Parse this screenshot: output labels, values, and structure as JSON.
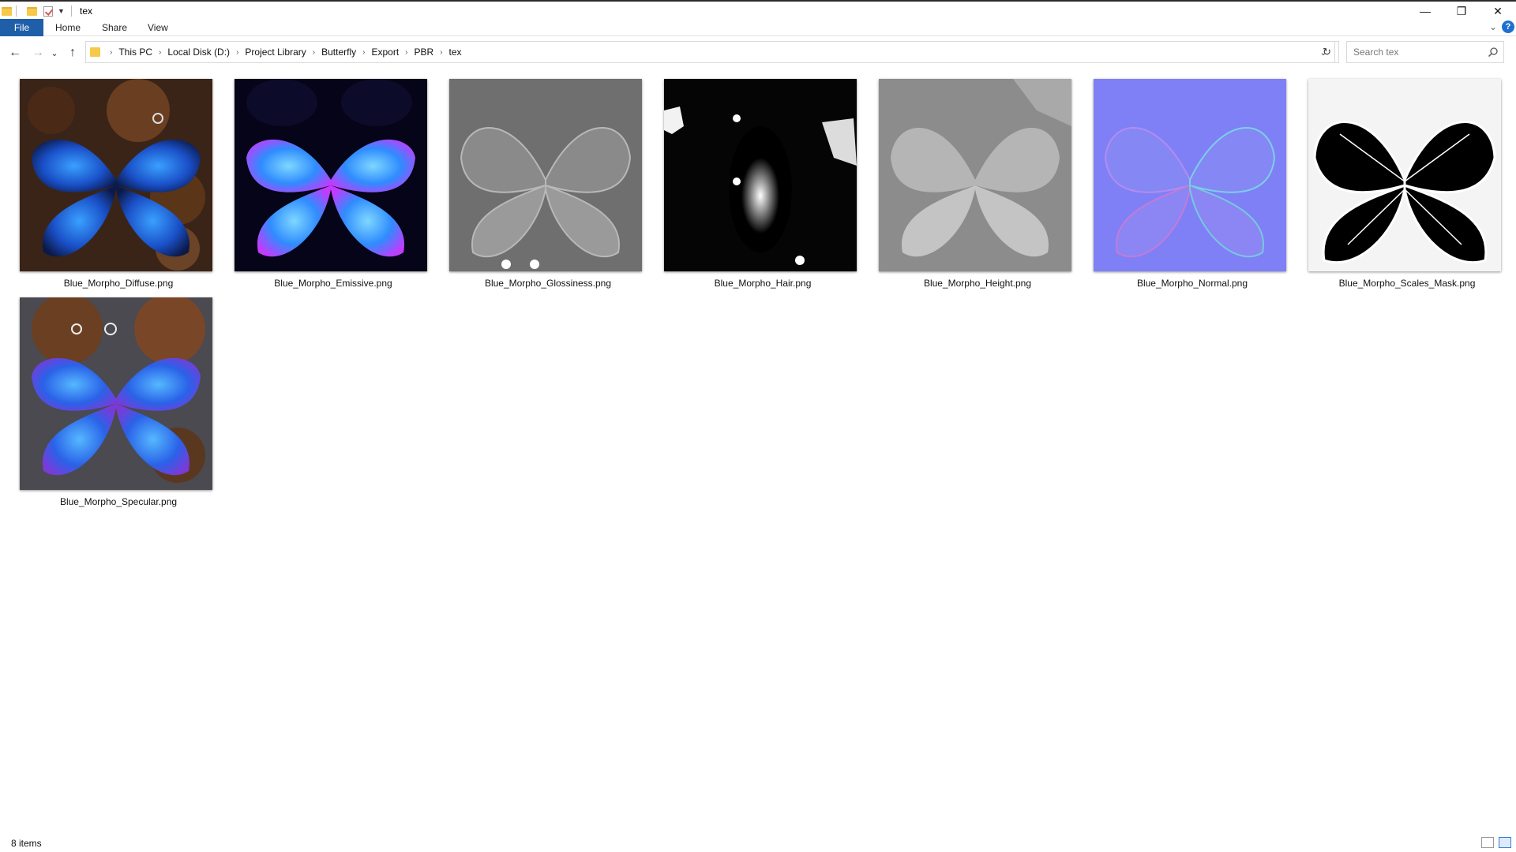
{
  "window": {
    "title": "tex",
    "controls": {
      "minimize": "—",
      "restore": "❐",
      "close": "✕"
    }
  },
  "ribbon": {
    "tabs": [
      {
        "label": "File",
        "active": true
      },
      {
        "label": "Home"
      },
      {
        "label": "Share"
      },
      {
        "label": "View"
      }
    ],
    "help": "?"
  },
  "nav": {
    "back": "←",
    "forward": "→",
    "recent": "⌄",
    "up": "↑",
    "breadcrumbs": [
      "This PC",
      "Local Disk (D:)",
      "Project Library",
      "Butterfly",
      "Export",
      "PBR",
      "tex"
    ],
    "refresh": "↻",
    "dropdown": "⌄"
  },
  "search": {
    "placeholder": "Search tex"
  },
  "files": [
    {
      "name": "Blue_Morpho_Diffuse.png",
      "kind": "diffuse"
    },
    {
      "name": "Blue_Morpho_Emissive.png",
      "kind": "emissive"
    },
    {
      "name": "Blue_Morpho_Glossiness.png",
      "kind": "glossiness"
    },
    {
      "name": "Blue_Morpho_Hair.png",
      "kind": "hair"
    },
    {
      "name": "Blue_Morpho_Height.png",
      "kind": "height"
    },
    {
      "name": "Blue_Morpho_Normal.png",
      "kind": "normal"
    },
    {
      "name": "Blue_Morpho_Scales_Mask.png",
      "kind": "mask"
    },
    {
      "name": "Blue_Morpho_Specular.png",
      "kind": "specular"
    }
  ],
  "status": {
    "item_count": "8 items"
  },
  "colors": {
    "file_tab": "#1f5ea8",
    "folder": "#f5c94a",
    "accent": "#1f6fcf"
  }
}
